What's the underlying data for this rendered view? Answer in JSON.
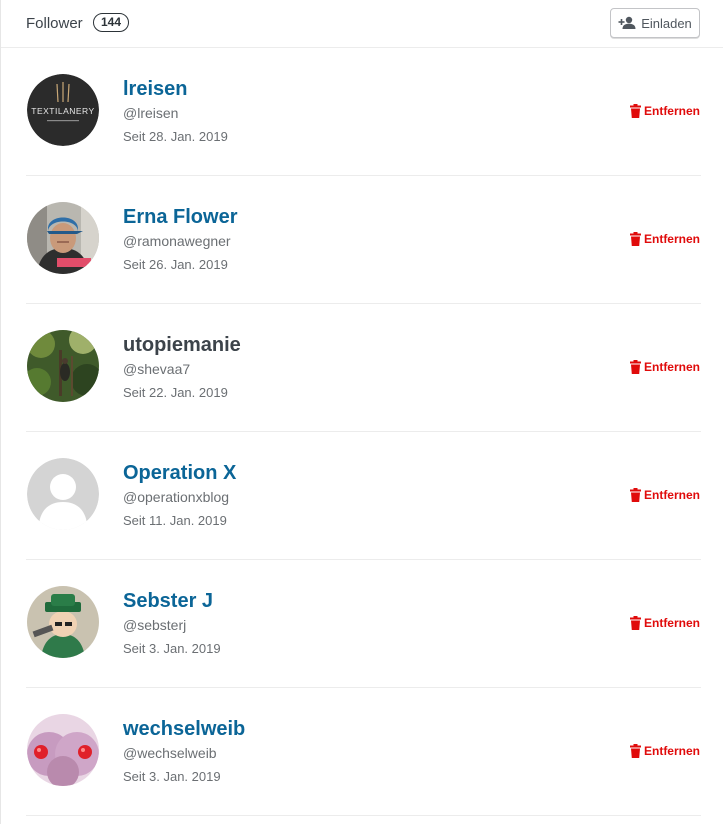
{
  "header": {
    "title": "Follower",
    "count": "144",
    "invite_label": "Einladen",
    "invite_icon": "person-plus-icon"
  },
  "followers": [
    {
      "name": "lreisen",
      "handle": "@lreisen",
      "since": "Seit 28. Jan. 2019",
      "remove_label": "Entfernen",
      "linked": true,
      "avatar_text": "TEXTILANERY"
    },
    {
      "name": "Erna Flower",
      "handle": "@ramonawegner",
      "since": "Seit 26. Jan. 2019",
      "remove_label": "Entfernen",
      "linked": true
    },
    {
      "name": "utopiemanie",
      "handle": "@shevaa7",
      "since": "Seit 22. Jan. 2019",
      "remove_label": "Entfernen",
      "linked": false
    },
    {
      "name": "Operation X",
      "handle": "@operationxblog",
      "since": "Seit 11. Jan. 2019",
      "remove_label": "Entfernen",
      "linked": true
    },
    {
      "name": "Sebster J",
      "handle": "@sebsterj",
      "since": "Seit 3. Jan. 2019",
      "remove_label": "Entfernen",
      "linked": true
    },
    {
      "name": "wechselweib",
      "handle": "@wechselweib",
      "since": "Seit 3. Jan. 2019",
      "remove_label": "Entfernen",
      "linked": true
    }
  ],
  "colors": {
    "link": "#0b6597",
    "remove": "#e00b0b",
    "muted": "#6b6f73"
  }
}
